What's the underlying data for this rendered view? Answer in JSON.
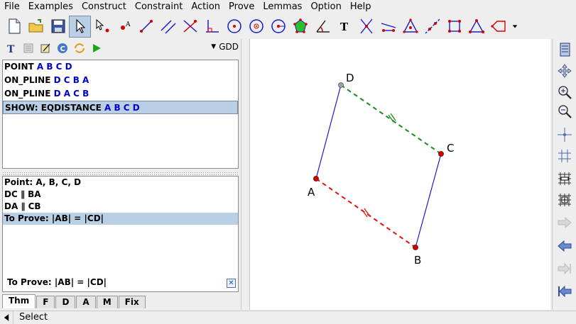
{
  "menu": [
    "File",
    "Examples",
    "Construct",
    "Constraint",
    "Action",
    "Prove",
    "Lemmas",
    "Option",
    "Help"
  ],
  "toolbar": {
    "icons": [
      "new-file-icon",
      "open-folder-icon",
      "save-icon",
      "select-pointer-icon",
      "draw-point-icon",
      "free-point-icon",
      "line-icon",
      "parallel-icon",
      "perpendicular-icon",
      "foot-icon",
      "circle-icon",
      "circle-three-points-icon",
      "compass-icon",
      "polygon-icon",
      "angle-icon",
      "text-icon",
      "intersection-icon",
      "mirror-icon",
      "triangle-icon",
      "locus-icon",
      "square-icon",
      "iso-triangle-icon",
      "transform-icon"
    ]
  },
  "left_panel": {
    "prover_select": "GDD",
    "script": [
      {
        "kw": "POINT",
        "args": "A B C D"
      },
      {
        "kw": "ON_PLINE",
        "args": "D C B A"
      },
      {
        "kw": "ON_PLINE",
        "args": "D A C B"
      },
      {
        "kw": "SHOW: EQDISTANCE",
        "args": "A B C D"
      }
    ],
    "facts": [
      "Point: A, B, C, D",
      "DC ∥ BA",
      "DA ∥ CB",
      "To Prove: |AB| = |CD|"
    ],
    "footer": "To Prove: |AB| = |CD|",
    "close_symbol": "✕",
    "tabs": [
      "Thm",
      "F",
      "D",
      "A",
      "M",
      "Fix"
    ]
  },
  "canvas": {
    "points": [
      {
        "label": "A"
      },
      {
        "label": "B"
      },
      {
        "label": "C"
      },
      {
        "label": "D"
      }
    ],
    "colors": {
      "side": "#1a1acc",
      "green_dash": "#1a8a1a",
      "red_dash": "#e01010",
      "point_fill": "#d40000",
      "point_D": "#a0a0a0"
    }
  },
  "status": {
    "text": "Select"
  }
}
